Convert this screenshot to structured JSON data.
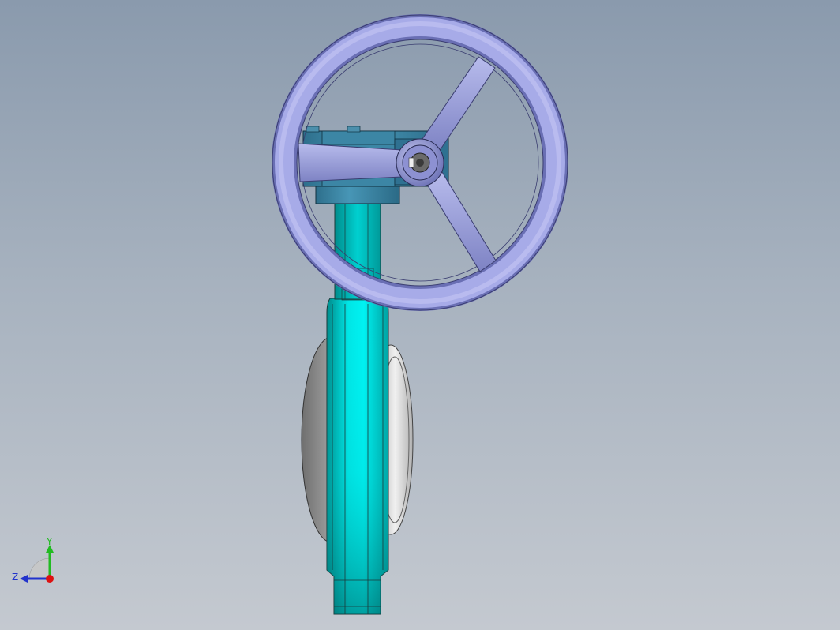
{
  "view": {
    "background_top": "#8a9aad",
    "background_bottom": "#c4c9d0"
  },
  "model": {
    "handwheel_color": "#9fa3e0",
    "handwheel_dark": "#6a6eb0",
    "gearbox_color": "#3d88a6",
    "gearbox_dark": "#1f5a72",
    "body_color": "#00e5e5",
    "body_dark": "#008f8f",
    "disc_color": "#d8d8d8",
    "disc_dark": "#7a7a7a"
  },
  "triad": {
    "y_label": "Y",
    "z_label": "Z",
    "y_color": "#22bb22",
    "z_color": "#2233cc",
    "x_color": "#dd1111"
  }
}
